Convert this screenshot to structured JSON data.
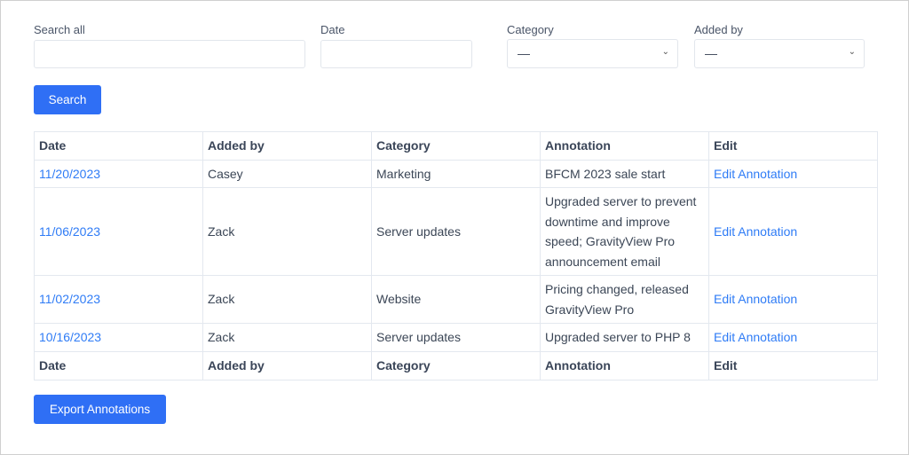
{
  "filters": {
    "search_all_label": "Search all",
    "search_all_value": "",
    "date_label": "Date",
    "date_value": "",
    "category_label": "Category",
    "category_value": "—",
    "added_by_label": "Added by",
    "added_by_value": "—",
    "search_button": "Search"
  },
  "table": {
    "headers": [
      "Date",
      "Added by",
      "Category",
      "Annotation",
      "Edit"
    ],
    "rows": [
      {
        "date": "11/20/2023",
        "added_by": "Casey",
        "category": "Marketing",
        "annotation": "BFCM 2023 sale start",
        "edit": "Edit Annotation"
      },
      {
        "date": "11/06/2023",
        "added_by": "Zack",
        "category": "Server updates",
        "annotation": "Upgraded server to prevent downtime and improve speed; GravityView Pro announcement email",
        "edit": "Edit Annotation"
      },
      {
        "date": "11/02/2023",
        "added_by": "Zack",
        "category": "Website",
        "annotation": "Pricing changed, released GravityView Pro",
        "edit": "Edit Annotation"
      },
      {
        "date": "10/16/2023",
        "added_by": "Zack",
        "category": "Server updates",
        "annotation": "Upgraded server to PHP 8",
        "edit": "Edit Annotation"
      }
    ],
    "footers": [
      "Date",
      "Added by",
      "Category",
      "Annotation",
      "Edit"
    ]
  },
  "export_button": "Export Annotations",
  "colors": {
    "accent": "#2f6ff5",
    "link": "#2f7cf6"
  }
}
